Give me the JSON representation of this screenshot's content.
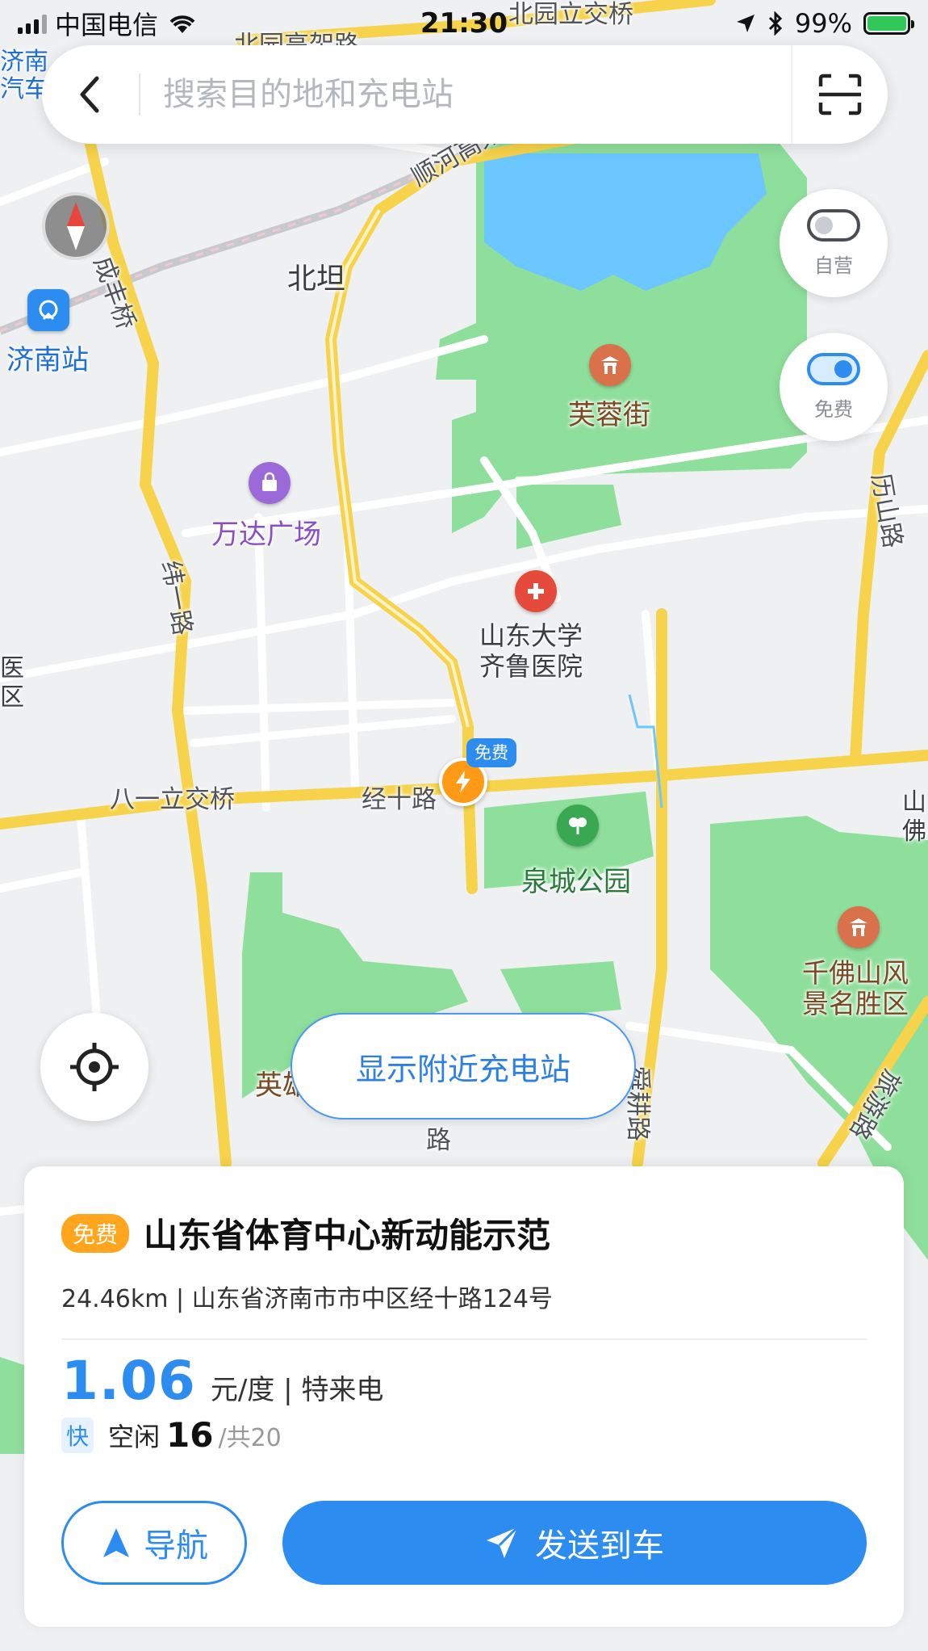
{
  "status_bar": {
    "carrier": "中国电信",
    "time": "21:30",
    "battery": "99%"
  },
  "search": {
    "placeholder": "搜索目的地和充电站"
  },
  "toggles": {
    "self_operated": {
      "label": "自营",
      "on": false
    },
    "free": {
      "label": "免费",
      "on": true
    }
  },
  "map_labels": {
    "jinan_station": "济南站",
    "wanda": "万达广场",
    "furong_street": "芙蓉街",
    "beitan": "北坦",
    "shunhe_elevated": "顺河高架路",
    "chengfeng_bridge": "成丰桥",
    "wei_1_road": "纬一路",
    "lishan_road": "历山路",
    "hospital": "山东大学\n齐鲁医院",
    "bayi_interchange": "八一立交桥",
    "jing_10_road": "经十路",
    "quancheng_park": "泉城公园",
    "qianfoshan": "千佛山风\n景名胜区",
    "shungeng_road": "舜耕路",
    "lvyou_road": "旅游路",
    "beiyuan_interchange": "北园立交桥",
    "beiyuan_elevated": "北园高架路",
    "jinan_car_left": "济南\n汽车",
    "ying_partial": "英雄",
    "lu_partial": "路",
    "right_edge_partial": "山\n佛",
    "left_edge_partial": "医\n区"
  },
  "marker": {
    "tag": "免费"
  },
  "nearby_button": "显示附近充电站",
  "station": {
    "badge": "免费",
    "name": "山东省体育中心新动能示范",
    "address": "24.46km | 山东省济南市市中区经十路124号",
    "price": "1.06",
    "price_unit": "元/度 | 特来电",
    "fast_label": "快",
    "idle_label": "空闲",
    "idle_count": "16",
    "total": "/共20"
  },
  "actions": {
    "navigate": "导航",
    "send_to_car": "发送到车"
  },
  "colors": {
    "accent": "#2d8cf0",
    "badge_orange": "#ffa51e",
    "park_green": "#8fdf9c",
    "road_yellow": "#f6d34a",
    "water": "#6cc6ff"
  }
}
